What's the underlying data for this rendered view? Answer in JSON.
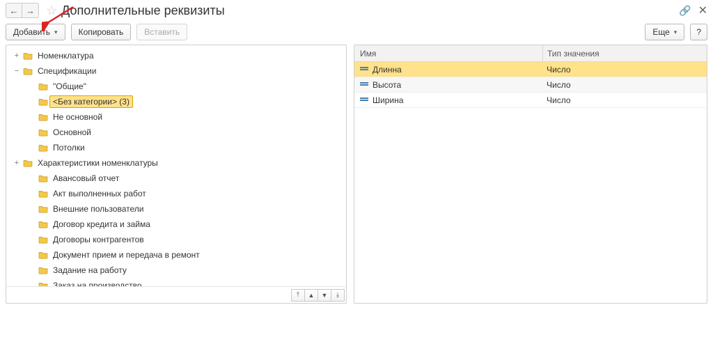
{
  "header": {
    "title": "Дополнительные реквизиты"
  },
  "toolbar": {
    "add_label": "Добавить",
    "copy_label": "Копировать",
    "paste_label": "Вставить",
    "more_label": "Еще",
    "help_label": "?"
  },
  "tree": {
    "items": [
      {
        "level": 0,
        "expander": "+",
        "label": "Номенклатура",
        "selected": false
      },
      {
        "level": 0,
        "expander": "−",
        "label": "Спецификации",
        "selected": false
      },
      {
        "level": 1,
        "expander": "",
        "label": "\"Общие\"",
        "selected": false
      },
      {
        "level": 1,
        "expander": "",
        "label": "<Без категории> (3)",
        "selected": true
      },
      {
        "level": 1,
        "expander": "",
        "label": "Не основной",
        "selected": false
      },
      {
        "level": 1,
        "expander": "",
        "label": "Основной",
        "selected": false
      },
      {
        "level": 1,
        "expander": "",
        "label": "Потолки",
        "selected": false
      },
      {
        "level": 0,
        "expander": "+",
        "label": "Характеристики номенклатуры",
        "selected": false
      },
      {
        "level": 1,
        "expander": "",
        "label": "Авансовый отчет",
        "selected": false
      },
      {
        "level": 1,
        "expander": "",
        "label": "Акт выполненных работ",
        "selected": false
      },
      {
        "level": 1,
        "expander": "",
        "label": "Внешние пользователи",
        "selected": false
      },
      {
        "level": 1,
        "expander": "",
        "label": "Договор кредита и займа",
        "selected": false
      },
      {
        "level": 1,
        "expander": "",
        "label": "Договоры контрагентов",
        "selected": false
      },
      {
        "level": 1,
        "expander": "",
        "label": "Документ прием и передача в ремонт",
        "selected": false
      },
      {
        "level": 1,
        "expander": "",
        "label": "Задание на работу",
        "selected": false
      },
      {
        "level": 1,
        "expander": "",
        "label": "Заказ на производство",
        "selected": false
      }
    ]
  },
  "grid": {
    "columns": {
      "name": "Имя",
      "type": "Тип значения"
    },
    "rows": [
      {
        "name": "Длинна",
        "type": "Число",
        "selected": true
      },
      {
        "name": "Высота",
        "type": "Число",
        "selected": false
      },
      {
        "name": "Ширина",
        "type": "Число",
        "selected": false
      }
    ]
  },
  "icons": {
    "back": "←",
    "forward": "→",
    "star": "☆",
    "link": "🔗",
    "close": "✕",
    "caret": "▾",
    "top": "⤒",
    "up": "▲",
    "down": "▼",
    "bottom": "⤓"
  },
  "annotation": {
    "arrow_color": "#d22"
  }
}
